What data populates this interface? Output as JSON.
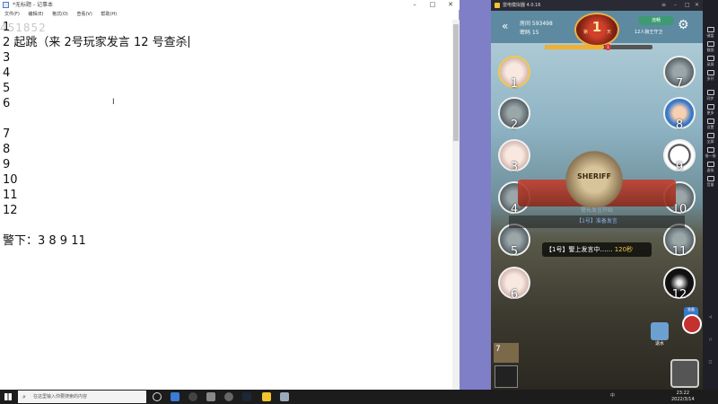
{
  "notepad": {
    "title": "*无标题 - 记事本",
    "watermark": "451852",
    "menu": [
      "文件(F)",
      "编辑(E)",
      "格式(O)",
      "查看(V)",
      "帮助(H)"
    ],
    "lines": [
      "1",
      "2 起跳（来 2号玩家发言 12 号查杀",
      "3",
      "4",
      "5",
      "6",
      "",
      "7",
      "8",
      "9",
      "10",
      "11",
      "12",
      "",
      "警下：3 8 9 11"
    ]
  },
  "emulator": {
    "app_name": "雷电模拟器 4.0.16",
    "game": {
      "room": "房间 593498",
      "password": "密码 15",
      "day_number": "1",
      "day_prefix": "第",
      "day_suffix": "天",
      "progress_badge": "1",
      "progress": 0.55,
      "voice_tag": "流畅",
      "mode": "12人狼王守卫",
      "seats": [
        "1",
        "2",
        "3",
        "4",
        "5",
        "6",
        "7",
        "8",
        "9",
        "10",
        "11",
        "12"
      ],
      "sheriff_text": "SHERIFF",
      "log_line_1": "警长发言开始",
      "log_line_2": "【1号】准备发言",
      "speaking_text": "【1号】警上发言中……",
      "speaking_seconds": "120秒",
      "withdraw_label": "退水",
      "side_tags": [
        "准备"
      ]
    },
    "toolbar": [
      "键盘",
      "截图",
      "录屏",
      "多开",
      "同步",
      "更多",
      "设置",
      "全屏",
      "摇一摇",
      "虚拟",
      "音量"
    ]
  },
  "taskbar": {
    "search_placeholder": "在这里输入你要搜索的内容",
    "time": "23:22",
    "date": "2022/3/14",
    "tray_text": "中"
  }
}
